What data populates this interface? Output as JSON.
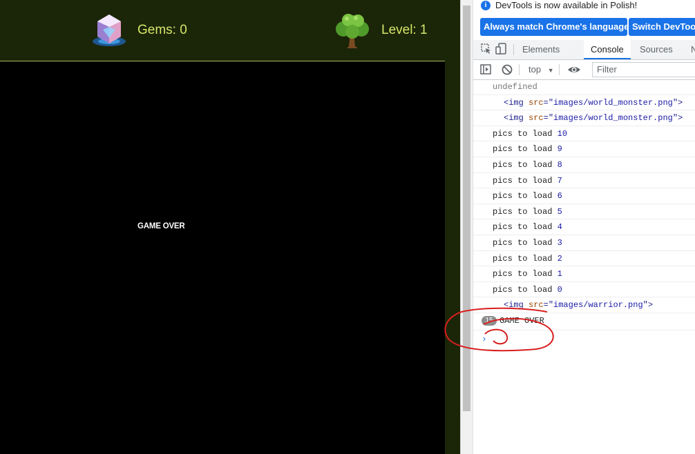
{
  "game": {
    "gems_label": "Gems: 0",
    "level_label": "Level: 1",
    "game_over_text": "GAME OVER",
    "colors": {
      "header_bg": "#1b2508",
      "hud_text": "#d7e86a",
      "canvas_bg": "#000000"
    },
    "icons": {
      "gems": "crystal-gem-icon",
      "level": "tree-icon"
    }
  },
  "devtools": {
    "info_bar": {
      "message": "DevTools is now available in Polish!",
      "match_button": "Always match Chrome's language",
      "switch_button": "Switch DevTools to Polish"
    },
    "tabs": [
      {
        "label": "Elements"
      },
      {
        "label": "Console",
        "selected": true
      },
      {
        "label": "Sources"
      },
      {
        "label": "N"
      }
    ],
    "toolbar": {
      "context": "top",
      "filter_placeholder": "Filter"
    },
    "console": {
      "undefined_line": "undefined",
      "img_rows": [
        {
          "src": "images/world_monster.png"
        },
        {
          "src": "images/world_monster.png"
        }
      ],
      "pics_label": "pics to load",
      "pics_counts": [
        "10",
        "9",
        "8",
        "7",
        "6",
        "5",
        "4",
        "3",
        "2",
        "1",
        "0"
      ],
      "warrior_src": "images/warrior.png",
      "repeat_count": "15",
      "game_over_message": "GAME OVER",
      "prompt_symbol": "›"
    },
    "accent_color": "#1a73e8"
  }
}
